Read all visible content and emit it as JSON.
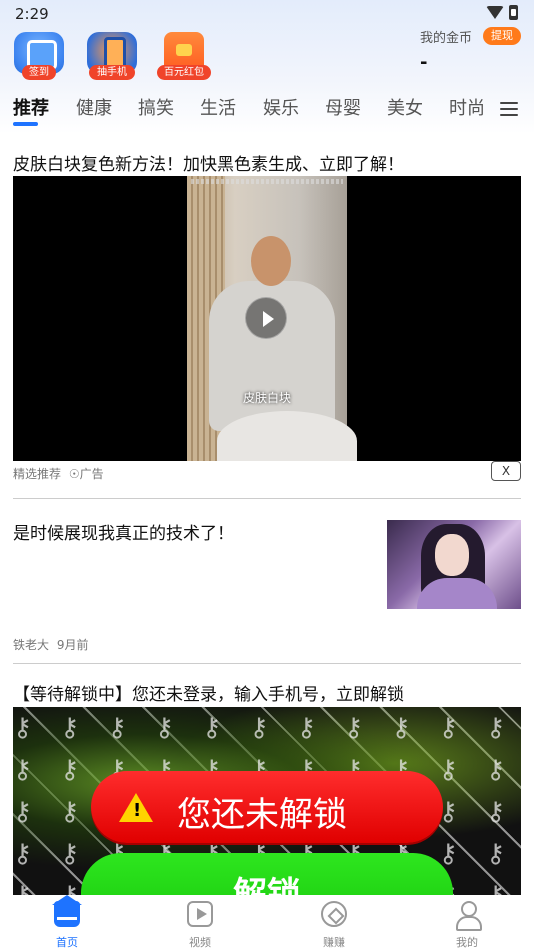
{
  "status_bar": {
    "time": "2:29"
  },
  "quick_actions": [
    {
      "label": "签到",
      "icon": "calendar-check-icon"
    },
    {
      "label": "抽手机",
      "icon": "phone-prize-icon"
    },
    {
      "label": "百元红包",
      "icon": "red-envelope-icon"
    }
  ],
  "coins": {
    "label": "我的金币",
    "withdraw_label": "提现",
    "value": "-"
  },
  "tabs": [
    "推荐",
    "健康",
    "搞笑",
    "生活",
    "娱乐",
    "母婴",
    "美女",
    "时尚"
  ],
  "active_tab": "推荐",
  "feed": {
    "item1": {
      "title": "皮肤白块复色新方法！加快黑色素生成、立即了解！",
      "video_caption": "皮肤白块",
      "source": "精选推荐",
      "ad_label": "广告",
      "close_label": "X"
    },
    "item2": {
      "title": "是时候展现我真正的技术了！",
      "author": "铁老大",
      "time": "9月前"
    },
    "item3": {
      "title": "【等待解锁中】您还未登录，输入手机号，立即解锁",
      "locked_text": "您还未解锁",
      "unlock_label": "解锁"
    }
  },
  "bottom_nav": [
    {
      "label": "首页",
      "icon": "home-icon",
      "active": true
    },
    {
      "label": "视频",
      "icon": "video-icon",
      "active": false
    },
    {
      "label": "赚赚",
      "icon": "earn-icon",
      "active": false
    },
    {
      "label": "我的",
      "icon": "profile-icon",
      "active": false
    }
  ],
  "colors": {
    "accent": "#1e73ff",
    "badge": "#f0442a",
    "withdraw": "#ff7a1a",
    "lock_red": "#e00000",
    "unlock_green": "#18c80c"
  }
}
